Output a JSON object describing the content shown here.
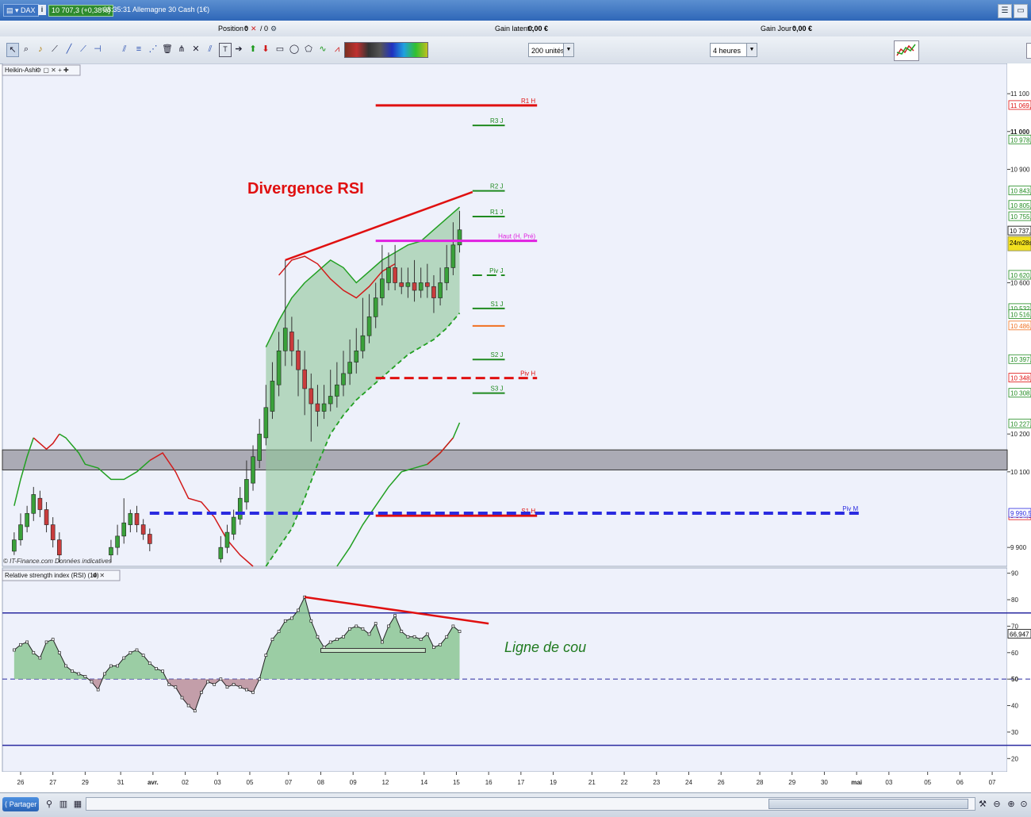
{
  "titlebar": {
    "instrument": "DAX",
    "price_change": "10 707,3 (+0,38%)",
    "time_title": "08:35:31 Allemagne 30 Cash (1€)"
  },
  "infobar": {
    "position_label": "Position :",
    "position_value": "0",
    "position_orders": "/ 0",
    "gain_latent_label": "Gain latent :",
    "gain_latent_value": "0,00 €",
    "gain_jour_label": "Gain Jour :",
    "gain_jour_value": "0,00 €"
  },
  "toolbar": {
    "units": "200 unités",
    "period": "4 heures"
  },
  "panels": {
    "main_label": "Heikin-Ashi",
    "rsi_label": "Relative strength index (RSI) (14)",
    "footer": "© IT-Finance.com Données indicatives"
  },
  "annotations": {
    "divergence": "Divergence RSI",
    "neckline": "Ligne de cou"
  },
  "levels": [
    {
      "label": "R1 H",
      "price": 11069,
      "x1": 11.0,
      "x2": 16.0,
      "color": "#e01010",
      "dash": false,
      "w": 3,
      "tag": "11 069,"
    },
    {
      "label": "R3 J",
      "price": 11016,
      "x1": 14.0,
      "x2": 15.0,
      "color": "#1f8a1f",
      "dash": false,
      "w": 2,
      "tag": ""
    },
    {
      "label": "",
      "price": 10978,
      "x1": null,
      "x2": null,
      "color": "#1f8a1f",
      "dash": false,
      "w": 0,
      "tag": "10 978,"
    },
    {
      "label": "R2 J",
      "price": 10843,
      "x1": 14.0,
      "x2": 15.0,
      "color": "#1f8a1f",
      "dash": false,
      "w": 2,
      "tag": "10 843,"
    },
    {
      "label": "",
      "price": 10805,
      "x1": null,
      "x2": null,
      "color": "#1f8a1f",
      "dash": false,
      "w": 0,
      "tag": "10 805,"
    },
    {
      "label": "R1 J",
      "price": 10775,
      "x1": 14.0,
      "x2": 15.0,
      "color": "#1f8a1f",
      "dash": false,
      "w": 2,
      "tag": "10 755,"
    },
    {
      "label": "Haut (H, Pré)",
      "price": 10711,
      "x1": 11.0,
      "x2": 16.0,
      "color": "#e020e0",
      "dash": false,
      "w": 3,
      "tag": ""
    },
    {
      "label": "Piv J",
      "price": 10620,
      "x1": 14.0,
      "x2": 15.0,
      "color": "#1f8a1f",
      "dash": true,
      "w": 2,
      "tag": "10 620,"
    },
    {
      "label": "S1 J",
      "price": 10532,
      "x1": 14.0,
      "x2": 15.0,
      "color": "#1f8a1f",
      "dash": false,
      "w": 2,
      "tag": "10 532,"
    },
    {
      "label": "",
      "price": 10516,
      "x1": null,
      "x2": null,
      "color": "#1f8a1f",
      "dash": false,
      "w": 0,
      "tag": "10 516,"
    },
    {
      "label": "",
      "price": 10486,
      "x1": 14.0,
      "x2": 15.0,
      "color": "#f07020",
      "dash": false,
      "w": 2,
      "tag": "10 486,"
    },
    {
      "label": "S2 J",
      "price": 10397,
      "x1": 14.0,
      "x2": 15.0,
      "color": "#1f8a1f",
      "dash": false,
      "w": 2,
      "tag": "10 397,"
    },
    {
      "label": "Piv H",
      "price": 10348,
      "x1": 11.0,
      "x2": 16.0,
      "color": "#e01010",
      "dash": true,
      "w": 3,
      "tag": "10 348,"
    },
    {
      "label": "S3 J",
      "price": 10308,
      "x1": 14.0,
      "x2": 15.0,
      "color": "#1f8a1f",
      "dash": false,
      "w": 2,
      "tag": "10 308,"
    },
    {
      "label": "",
      "price": 10227,
      "x1": null,
      "x2": null,
      "color": "#1f8a1f",
      "dash": false,
      "w": 0,
      "tag": "10 227,"
    },
    {
      "label": "S1 H",
      "price": 9984,
      "x1": 11.0,
      "x2": 16.0,
      "color": "#e01010",
      "dash": false,
      "w": 3,
      "tag": "9 984,9"
    },
    {
      "label": "Piv M",
      "price": 9990.5,
      "x1": 4.0,
      "x2": 26.0,
      "color": "#2a2ae0",
      "dash": true,
      "w": 4,
      "tag": "9 990,5"
    }
  ],
  "zone": {
    "top": 10158,
    "bottom": 10105
  },
  "chart_data": [
    {
      "type": "candlestick",
      "title": "Heikin-Ashi",
      "ylim": [
        9850,
        11180
      ],
      "yticks": [
        {
          "v": 11100,
          "label": "11 100"
        },
        {
          "v": 11000,
          "label": "11 000"
        },
        {
          "v": 10900,
          "label": "10 900"
        },
        {
          "v": 10600,
          "label": "10 600"
        },
        {
          "v": 10200,
          "label": "10 200"
        },
        {
          "v": 10100,
          "label": "10 100"
        },
        {
          "v": 9900,
          "label": "9 900"
        }
      ],
      "last_price": {
        "value": 10737,
        "label": "10 737,",
        "timer": "24m28s"
      },
      "candles": [
        [
          -0.2,
          9890,
          9920,
          9880,
          9940
        ],
        [
          0.0,
          9920,
          9960,
          9905,
          9990
        ],
        [
          0.2,
          9955,
          9990,
          9940,
          10010
        ],
        [
          0.4,
          9990,
          10040,
          9970,
          10060
        ],
        [
          0.6,
          10030,
          10000,
          9980,
          10050
        ],
        [
          0.8,
          10000,
          9960,
          9940,
          10020
        ],
        [
          1.0,
          9960,
          9920,
          9900,
          9980
        ],
        [
          1.2,
          9920,
          9880,
          9860,
          9940
        ],
        [
          2.8,
          9880,
          9900,
          9860,
          9920
        ],
        [
          3.0,
          9900,
          9930,
          9880,
          9960
        ],
        [
          3.2,
          9930,
          9965,
          9910,
          10030
        ],
        [
          3.4,
          9960,
          9990,
          9940,
          10000
        ],
        [
          3.6,
          9990,
          9960,
          9940,
          10010
        ],
        [
          3.8,
          9960,
          9935,
          9920,
          9975
        ],
        [
          4.0,
          9935,
          9910,
          9890,
          9950
        ],
        [
          6.2,
          9870,
          9900,
          9860,
          9930
        ],
        [
          6.4,
          9900,
          9940,
          9885,
          9960
        ],
        [
          6.6,
          9935,
          9980,
          9920,
          10000
        ],
        [
          6.8,
          9975,
          10030,
          9960,
          10060
        ],
        [
          7.0,
          10020,
          10080,
          10000,
          10130
        ],
        [
          7.2,
          10070,
          10140,
          10050,
          10170
        ],
        [
          7.4,
          10130,
          10200,
          10110,
          10240
        ],
        [
          7.6,
          10190,
          10270,
          10170,
          10330
        ],
        [
          7.8,
          10260,
          10340,
          10240,
          10390
        ],
        [
          8.0,
          10330,
          10420,
          10300,
          10470
        ],
        [
          8.2,
          10420,
          10480,
          10380,
          10660
        ],
        [
          8.4,
          10470,
          10420,
          10380,
          10510
        ],
        [
          8.6,
          10420,
          10370,
          10300,
          10450
        ],
        [
          8.8,
          10370,
          10320,
          10250,
          10420
        ],
        [
          9.0,
          10320,
          10280,
          10180,
          10360
        ],
        [
          9.2,
          10280,
          10260,
          10220,
          10330
        ],
        [
          9.4,
          10260,
          10280,
          10240,
          10330
        ],
        [
          9.6,
          10280,
          10300,
          10260,
          10370
        ],
        [
          9.8,
          10300,
          10330,
          10270,
          10390
        ],
        [
          10.0,
          10330,
          10360,
          10300,
          10420
        ],
        [
          10.2,
          10360,
          10390,
          10330,
          10450
        ],
        [
          10.4,
          10390,
          10420,
          10360,
          10480
        ],
        [
          10.6,
          10420,
          10460,
          10400,
          10560
        ],
        [
          10.8,
          10460,
          10510,
          10440,
          10570
        ],
        [
          11.0,
          10510,
          10560,
          10480,
          10600
        ],
        [
          11.2,
          10560,
          10610,
          10540,
          10700
        ],
        [
          11.4,
          10600,
          10640,
          10580,
          10680
        ],
        [
          11.6,
          10640,
          10600,
          10580,
          10700
        ],
        [
          11.8,
          10600,
          10590,
          10570,
          10640
        ],
        [
          12.0,
          10590,
          10600,
          10560,
          10640
        ],
        [
          12.2,
          10600,
          10580,
          10550,
          10660
        ],
        [
          12.4,
          10580,
          10600,
          10560,
          10640
        ],
        [
          12.6,
          10600,
          10590,
          10560,
          10650
        ],
        [
          12.8,
          10590,
          10560,
          10520,
          10620
        ],
        [
          13.0,
          10560,
          10600,
          10540,
          10640
        ],
        [
          13.2,
          10600,
          10640,
          10580,
          10700
        ],
        [
          13.4,
          10640,
          10700,
          10620,
          10760
        ],
        [
          13.6,
          10700,
          10740,
          10680,
          10790
        ]
      ],
      "band_upper": [
        [
          -0.2,
          10010
        ],
        [
          0.0,
          10080
        ],
        [
          0.2,
          10140
        ],
        [
          0.4,
          10190
        ],
        [
          0.6,
          10175
        ],
        [
          0.8,
          10160
        ],
        [
          1.0,
          10175
        ],
        [
          1.2,
          10200
        ],
        [
          1.4,
          10190
        ],
        [
          1.6,
          10170
        ],
        [
          1.8,
          10150
        ],
        [
          2.0,
          10120
        ],
        [
          2.4,
          10110
        ],
        [
          2.8,
          10080
        ],
        [
          3.2,
          10080
        ],
        [
          3.6,
          10100
        ],
        [
          4.0,
          10130
        ],
        [
          4.4,
          10150
        ],
        [
          4.8,
          10100
        ],
        [
          5.2,
          10030
        ],
        [
          5.6,
          10020
        ],
        [
          6.0,
          9980
        ],
        [
          6.4,
          9920
        ],
        [
          6.8,
          9880
        ],
        [
          7.2,
          9850
        ]
      ],
      "band_mid_upper": [
        [
          7.6,
          10430
        ],
        [
          8.0,
          10500
        ],
        [
          8.4,
          10560
        ],
        [
          8.8,
          10600
        ],
        [
          9.2,
          10630
        ],
        [
          9.6,
          10660
        ],
        [
          10.0,
          10640
        ],
        [
          10.4,
          10600
        ],
        [
          10.8,
          10630
        ],
        [
          11.2,
          10660
        ],
        [
          11.6,
          10680
        ],
        [
          12.0,
          10700
        ],
        [
          12.4,
          10710
        ],
        [
          12.8,
          10740
        ],
        [
          13.2,
          10770
        ],
        [
          13.6,
          10800
        ]
      ],
      "band_lower": [
        [
          7.6,
          9850
        ],
        [
          8.0,
          9900
        ],
        [
          8.4,
          9950
        ],
        [
          8.8,
          10030
        ],
        [
          9.2,
          10120
        ],
        [
          9.6,
          10200
        ],
        [
          10.0,
          10250
        ],
        [
          10.4,
          10290
        ],
        [
          10.8,
          10320
        ],
        [
          11.2,
          10350
        ],
        [
          11.6,
          10380
        ],
        [
          12.0,
          10410
        ],
        [
          12.4,
          10430
        ],
        [
          12.8,
          10450
        ],
        [
          13.2,
          10480
        ],
        [
          13.6,
          10520
        ]
      ],
      "band_red": [
        [
          8.0,
          10620
        ],
        [
          8.4,
          10660
        ],
        [
          8.8,
          10670
        ],
        [
          9.2,
          10650
        ],
        [
          9.6,
          10610
        ],
        [
          10.0,
          10580
        ],
        [
          10.4,
          10560
        ],
        [
          10.8,
          10590
        ],
        [
          11.2,
          10630
        ],
        [
          11.6,
          10650
        ]
      ],
      "band_green_low": [
        [
          9.8,
          9850
        ],
        [
          10.2,
          9900
        ],
        [
          10.6,
          9960
        ],
        [
          11.0,
          10010
        ],
        [
          11.4,
          10060
        ],
        [
          11.8,
          10100
        ],
        [
          12.2,
          10110
        ],
        [
          12.6,
          10120
        ],
        [
          13.0,
          10150
        ],
        [
          13.4,
          10190
        ],
        [
          13.6,
          10230
        ]
      ],
      "divergence_line": [
        [
          8.2,
          10660
        ],
        [
          14.0,
          10840
        ]
      ]
    },
    {
      "type": "area",
      "title": "Relative strength index (RSI) (14)",
      "ylim": [
        15,
        92
      ],
      "yticks": [
        90,
        80,
        70,
        60,
        50,
        40,
        30,
        20
      ],
      "overbought": 75,
      "oversold": 25,
      "midline": 50,
      "last_value": "66,947",
      "values": [
        [
          -0.2,
          61
        ],
        [
          0.0,
          63
        ],
        [
          0.2,
          64
        ],
        [
          0.4,
          60
        ],
        [
          0.6,
          58
        ],
        [
          0.8,
          64
        ],
        [
          1.0,
          65
        ],
        [
          1.2,
          60
        ],
        [
          1.4,
          55
        ],
        [
          1.6,
          53
        ],
        [
          1.8,
          52
        ],
        [
          2.0,
          51
        ],
        [
          2.2,
          49
        ],
        [
          2.4,
          46
        ],
        [
          2.6,
          52
        ],
        [
          2.8,
          55
        ],
        [
          3.0,
          55
        ],
        [
          3.2,
          58
        ],
        [
          3.4,
          60
        ],
        [
          3.6,
          61
        ],
        [
          3.8,
          59
        ],
        [
          4.0,
          56
        ],
        [
          4.2,
          54
        ],
        [
          4.4,
          53
        ],
        [
          4.6,
          48
        ],
        [
          4.8,
          47
        ],
        [
          5.0,
          43
        ],
        [
          5.2,
          40
        ],
        [
          5.4,
          38
        ],
        [
          5.6,
          45
        ],
        [
          5.8,
          49
        ],
        [
          6.0,
          48
        ],
        [
          6.2,
          50
        ],
        [
          6.4,
          47
        ],
        [
          6.6,
          48
        ],
        [
          6.8,
          47
        ],
        [
          7.0,
          46
        ],
        [
          7.2,
          45
        ],
        [
          7.4,
          50
        ],
        [
          7.6,
          59
        ],
        [
          7.8,
          65
        ],
        [
          8.0,
          68
        ],
        [
          8.2,
          72
        ],
        [
          8.4,
          73
        ],
        [
          8.6,
          76
        ],
        [
          8.8,
          81
        ],
        [
          9.0,
          72
        ],
        [
          9.2,
          66
        ],
        [
          9.4,
          62
        ],
        [
          9.6,
          64
        ],
        [
          9.8,
          65
        ],
        [
          10.0,
          66
        ],
        [
          10.2,
          69
        ],
        [
          10.4,
          70
        ],
        [
          10.6,
          69
        ],
        [
          10.8,
          67
        ],
        [
          11.0,
          71
        ],
        [
          11.2,
          64
        ],
        [
          11.4,
          70
        ],
        [
          11.6,
          74
        ],
        [
          11.8,
          68
        ],
        [
          12.0,
          66
        ],
        [
          12.2,
          66
        ],
        [
          12.4,
          65
        ],
        [
          12.6,
          67
        ],
        [
          12.8,
          62
        ],
        [
          13.0,
          63
        ],
        [
          13.2,
          66
        ],
        [
          13.4,
          70
        ],
        [
          13.6,
          68
        ]
      ],
      "divergence_line": [
        [
          8.8,
          81
        ],
        [
          14.5,
          71
        ]
      ],
      "neckline": [
        9.3,
        17.4,
        61
      ]
    }
  ],
  "xaxis": {
    "labels": [
      "26",
      "27",
      "29",
      "31",
      "avr.",
      "02",
      "03",
      "05",
      "07",
      "08",
      "09",
      "12",
      "14",
      "15",
      "16",
      "17",
      "19",
      "21",
      "22",
      "23",
      "24",
      "26",
      "28",
      "29",
      "30",
      "mai",
      "03",
      "05",
      "06",
      "07"
    ],
    "positions": [
      0.7,
      1.7,
      2.7,
      3.8,
      4.8,
      5.8,
      6.8,
      7.8,
      9.0,
      10.0,
      11.0,
      12.0,
      13.2,
      14.2,
      15.2,
      16.2,
      17.2,
      18.4,
      19.4,
      20.4,
      21.4,
      22.4,
      23.6,
      24.6,
      25.6,
      26.6,
      27.6,
      28.8,
      29.8,
      30.8
    ],
    "bold": [
      "avr.",
      "mai"
    ]
  }
}
